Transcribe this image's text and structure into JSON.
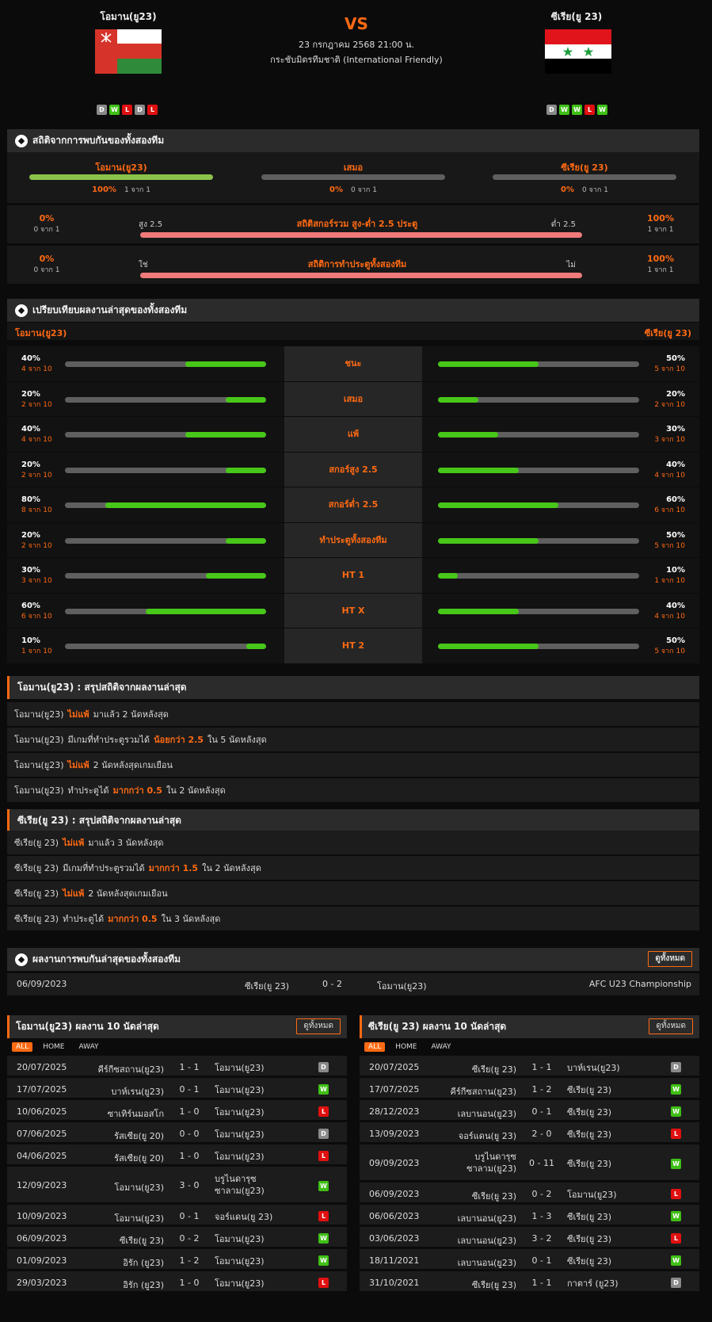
{
  "header": {
    "home_name": "โอมาน(ยู23)",
    "away_name": "ซีเรีย(ยู 23)",
    "vs": "VS",
    "date": "23 กรกฎาคม 2568 21:00 น.",
    "competition": "กระชับมิตรทีมชาติ (International Friendly)",
    "home_form": [
      "D",
      "W",
      "L",
      "D",
      "L"
    ],
    "away_form": [
      "D",
      "W",
      "W",
      "L",
      "W"
    ]
  },
  "h2h_stats": {
    "title": "สถิติจากการพบกันของทั้งสองทีม",
    "cols": [
      {
        "name": "โอมาน(ยู23)",
        "pct": "100%",
        "count": "1 จาก 1",
        "fraction": 1.0
      },
      {
        "name": "เสมอ",
        "pct": "0%",
        "count": "0 จาก 1",
        "fraction": 0
      },
      {
        "name": "ซีเรีย(ยู 23)",
        "pct": "0%",
        "count": "0 จาก 1",
        "fraction": 0
      }
    ],
    "ou": {
      "title": "สถิติสกอร์รวม สูง-ต่ำ 2.5 ประตู",
      "left_label": "สูง 2.5",
      "right_label": "ต่ำ 2.5",
      "left_pct": "0%",
      "left_count": "0 จาก 1",
      "right_pct": "100%",
      "right_count": "1 จาก 1"
    },
    "btts": {
      "title": "สถิติการทำประตูทั้งสองทีม",
      "left_label": "ใช่",
      "right_label": "ไม่",
      "left_pct": "0%",
      "left_count": "0 จาก 1",
      "right_pct": "100%",
      "right_count": "1 จาก 1"
    }
  },
  "compare": {
    "title": "เปรียบเทียบผลงานล่าสุดของทั้งสองทีม",
    "home": "โอมาน(ยู23)",
    "away": "ซีเรีย(ยู 23)",
    "rows": [
      {
        "label": "ชนะ",
        "l_pct": "40%",
        "l_cnt": "4 จาก 10",
        "l_val": 0.4,
        "r_pct": "50%",
        "r_cnt": "5 จาก 10",
        "r_val": 0.5
      },
      {
        "label": "เสมอ",
        "l_pct": "20%",
        "l_cnt": "2 จาก 10",
        "l_val": 0.2,
        "r_pct": "20%",
        "r_cnt": "2 จาก 10",
        "r_val": 0.2
      },
      {
        "label": "แพ้",
        "l_pct": "40%",
        "l_cnt": "4 จาก 10",
        "l_val": 0.4,
        "r_pct": "30%",
        "r_cnt": "3 จาก 10",
        "r_val": 0.3
      },
      {
        "label": "สกอร์สูง 2.5",
        "l_pct": "20%",
        "l_cnt": "2 จาก 10",
        "l_val": 0.2,
        "r_pct": "40%",
        "r_cnt": "4 จาก 10",
        "r_val": 0.4
      },
      {
        "label": "สกอร์ต่ำ 2.5",
        "l_pct": "80%",
        "l_cnt": "8 จาก 10",
        "l_val": 0.8,
        "r_pct": "60%",
        "r_cnt": "6 จาก 10",
        "r_val": 0.6
      },
      {
        "label": "ทำประตูทั้งสองทีม",
        "l_pct": "20%",
        "l_cnt": "2 จาก 10",
        "l_val": 0.2,
        "r_pct": "50%",
        "r_cnt": "5 จาก 10",
        "r_val": 0.5
      },
      {
        "label": "HT 1",
        "l_pct": "30%",
        "l_cnt": "3 จาก 10",
        "l_val": 0.3,
        "r_pct": "10%",
        "r_cnt": "1 จาก 10",
        "r_val": 0.1
      },
      {
        "label": "HT X",
        "l_pct": "60%",
        "l_cnt": "6 จาก 10",
        "l_val": 0.6,
        "r_pct": "40%",
        "r_cnt": "4 จาก 10",
        "r_val": 0.4
      },
      {
        "label": "HT 2",
        "l_pct": "10%",
        "l_cnt": "1 จาก 10",
        "l_val": 0.1,
        "r_pct": "50%",
        "r_cnt": "5 จาก 10",
        "r_val": 0.5
      }
    ]
  },
  "home_summary": {
    "title": "โอมาน(ยู23) : สรุปสถิติจากผลงานล่าสุด",
    "rows": [
      {
        "team": "โอมาน(ยู23)",
        "pre": "",
        "hl": "ไม่แพ้",
        "post": "มาแล้ว 2 นัดหลังสุด"
      },
      {
        "team": "โอมาน(ยู23)",
        "pre": "มีเกมที่ทำประตูรวมได้",
        "hl": "น้อยกว่า  2.5",
        "post": "ใน 5 นัดหลังสุด"
      },
      {
        "team": "โอมาน(ยู23)",
        "pre": "",
        "hl": "ไม่แพ้",
        "post": "2  นัดหลังสุดเกมเยือน"
      },
      {
        "team": "โอมาน(ยู23)",
        "pre": "ทำประตูได้",
        "hl": "มากกว่า  0.5",
        "post": "ใน 2 นัดหลังสุด"
      }
    ]
  },
  "away_summary": {
    "title": "ซีเรีย(ยู 23) : สรุปสถิติจากผลงานล่าสุด",
    "rows": [
      {
        "team": "ซีเรีย(ยู 23)",
        "pre": "",
        "hl": "ไม่แพ้",
        "post": "มาแล้ว 3 นัดหลังสุด"
      },
      {
        "team": "ซีเรีย(ยู 23)",
        "pre": "มีเกมที่ทำประตูรวมได้",
        "hl": "มากกว่า  1.5",
        "post": "ใน 2 นัดหลังสุด"
      },
      {
        "team": "ซีเรีย(ยู 23)",
        "pre": "",
        "hl": "ไม่แพ้",
        "post": "2  นัดหลังสุดเกมเยือน"
      },
      {
        "team": "ซีเรีย(ยู 23)",
        "pre": "ทำประตูได้",
        "hl": "มากกว่า  0.5",
        "post": "ใน 3 นัดหลังสุด"
      }
    ]
  },
  "h2h_matches": {
    "title": "ผลงานการพบกันล่าสุดของทั้งสองทีม",
    "see_all": "ดูทั้งหมด",
    "match": {
      "date": "06/09/2023",
      "home": "ซีเรีย(ยู 23)",
      "score": "0 - 2",
      "away": "โอมาน(ยู23)",
      "comp": "AFC U23 Championship"
    }
  },
  "tabs": [
    "ALL",
    "HOME",
    "AWAY"
  ],
  "home_last10": {
    "title": "โอมาน(ยู23) ผลงาน 10 นัดล่าสุด",
    "see_all": "ดูทั้งหมด",
    "matches": [
      {
        "date": "20/07/2025",
        "home": "คีร์กีซสถาน(ยู23)",
        "score": "1 - 1",
        "away": "โอมาน(ยู23)",
        "res": "D"
      },
      {
        "date": "17/07/2025",
        "home": "บาห์เรน(ยู23)",
        "score": "0 - 1",
        "away": "โอมาน(ยู23)",
        "res": "W"
      },
      {
        "date": "10/06/2025",
        "home": "ซาเทิร์นมอสโก",
        "score": "1 - 0",
        "away": "โอมาน(ยู23)",
        "res": "L"
      },
      {
        "date": "07/06/2025",
        "home": "รัสเซีย(ยู 20)",
        "score": "0 - 0",
        "away": "โอมาน(ยู23)",
        "res": "D"
      },
      {
        "date": "04/06/2025",
        "home": "รัสเซีย(ยู 20)",
        "score": "1 - 0",
        "away": "โอมาน(ยู23)",
        "res": "L"
      },
      {
        "date": "12/09/2023",
        "home": "โอมาน(ยู23)",
        "score": "3 - 0",
        "away": "บรูไนดารุซ ซาลาม(ยู23)",
        "res": "W",
        "tall": true
      },
      {
        "date": "10/09/2023",
        "home": "โอมาน(ยู23)",
        "score": "0 - 1",
        "away": "จอร์แดน(ยู 23)",
        "res": "L"
      },
      {
        "date": "06/09/2023",
        "home": "ซีเรีย(ยู 23)",
        "score": "0 - 2",
        "away": "โอมาน(ยู23)",
        "res": "W"
      },
      {
        "date": "01/09/2023",
        "home": "อิรัก (ยู23)",
        "score": "1 - 2",
        "away": "โอมาน(ยู23)",
        "res": "W"
      },
      {
        "date": "29/03/2023",
        "home": "อิรัก (ยู23)",
        "score": "1 - 0",
        "away": "โอมาน(ยู23)",
        "res": "L"
      }
    ]
  },
  "away_last10": {
    "title": "ซีเรีย(ยู 23) ผลงาน 10 นัดล่าสุด",
    "see_all": "ดูทั้งหมด",
    "matches": [
      {
        "date": "20/07/2025",
        "home": "ซีเรีย(ยู 23)",
        "score": "1 - 1",
        "away": "บาห์เรน(ยู23)",
        "res": "D"
      },
      {
        "date": "17/07/2025",
        "home": "คีร์กีซสถาน(ยู23)",
        "score": "1 - 2",
        "away": "ซีเรีย(ยู 23)",
        "res": "W"
      },
      {
        "date": "28/12/2023",
        "home": "เลบานอน(ยู23)",
        "score": "0 - 1",
        "away": "ซีเรีย(ยู 23)",
        "res": "W"
      },
      {
        "date": "13/09/2023",
        "home": "จอร์แดน(ยู 23)",
        "score": "2 - 0",
        "away": "ซีเรีย(ยู 23)",
        "res": "L"
      },
      {
        "date": "09/09/2023",
        "home": "บรูไนดารุซ ซาลาม(ยู23)",
        "score": "0 - 11",
        "away": "ซีเรีย(ยู 23)",
        "res": "W",
        "tall": true
      },
      {
        "date": "06/09/2023",
        "home": "ซีเรีย(ยู 23)",
        "score": "0 - 2",
        "away": "โอมาน(ยู23)",
        "res": "L"
      },
      {
        "date": "06/06/2023",
        "home": "เลบานอน(ยู23)",
        "score": "1 - 3",
        "away": "ซีเรีย(ยู 23)",
        "res": "W"
      },
      {
        "date": "03/06/2023",
        "home": "เลบานอน(ยู23)",
        "score": "3 - 2",
        "away": "ซีเรีย(ยู 23)",
        "res": "L"
      },
      {
        "date": "18/11/2021",
        "home": "เลบานอน(ยู23)",
        "score": "0 - 1",
        "away": "ซีเรีย(ยู 23)",
        "res": "W"
      },
      {
        "date": "31/10/2021",
        "home": "ซีเรีย(ยู 23)",
        "score": "1 - 1",
        "away": "กาตาร์ (ยู23)",
        "res": "D"
      }
    ]
  },
  "colors": {
    "accent": "#ff6a13",
    "win": "#3fbf16",
    "loss": "#e01010",
    "draw": "#8a8a8a",
    "bar_green": "#47c718",
    "bar_red": "#f07a7a"
  }
}
